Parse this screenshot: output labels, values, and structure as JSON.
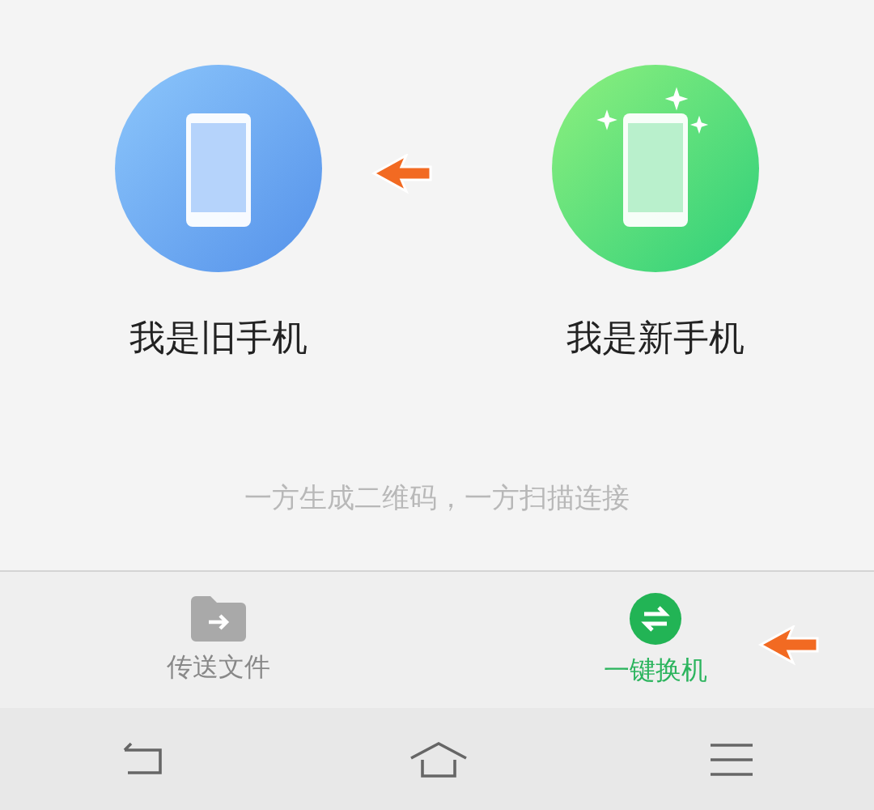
{
  "options": [
    {
      "kind": "old",
      "label": "我是旧手机"
    },
    {
      "kind": "new",
      "label": "我是新手机"
    }
  ],
  "hint": "一方生成二维码，一方扫描连接",
  "tabs": [
    {
      "kind": "file",
      "label": "传送文件",
      "selected": false
    },
    {
      "kind": "switch",
      "label": "一键换机",
      "selected": true
    }
  ]
}
